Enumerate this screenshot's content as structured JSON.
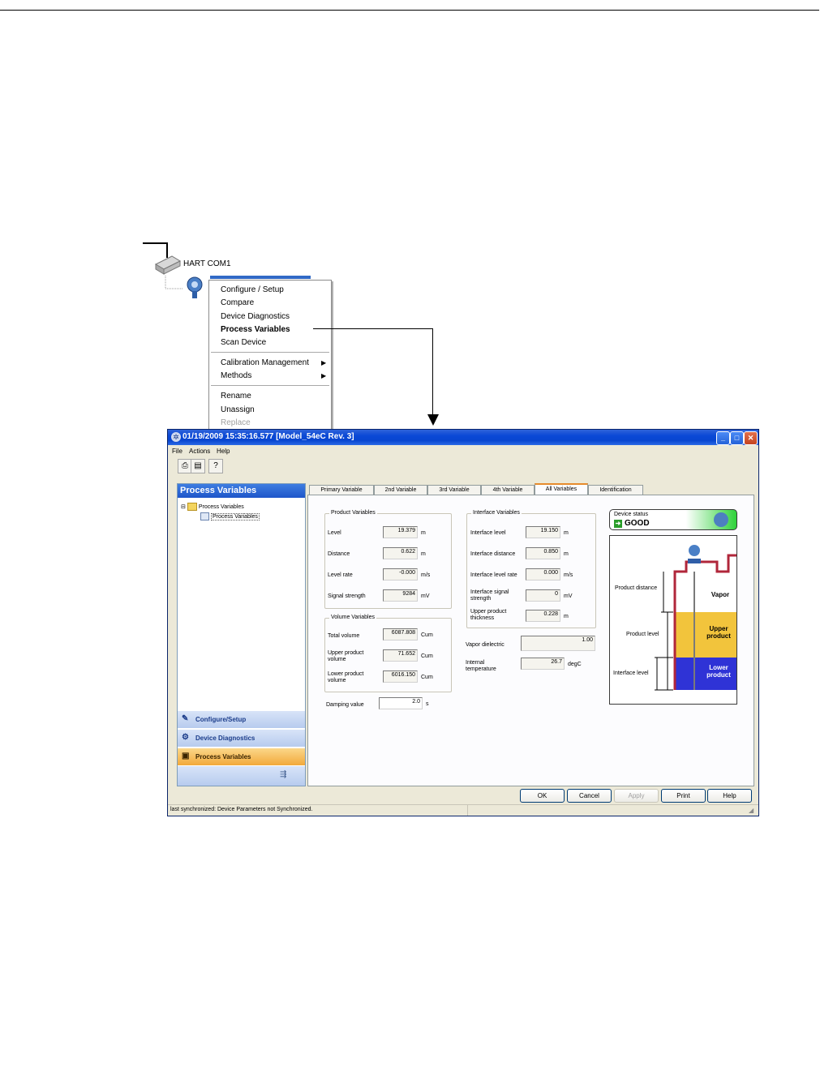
{
  "tree": {
    "hart_label": "HART COM1"
  },
  "context_menu": {
    "group1": [
      "Configure / Setup",
      "Compare",
      "Device Diagnostics",
      "Process Variables",
      "Scan Device"
    ],
    "group2": [
      "Calibration Management",
      "Methods"
    ],
    "group3": [
      "Rename",
      "Unassign",
      "Replace"
    ]
  },
  "window": {
    "title": "01/19/2009 15:35:16.577 [Model_54eC Rev. 3]",
    "menus": [
      "File",
      "Actions",
      "Help"
    ],
    "left_title": "Process Variables",
    "tree_root": "Process Variables",
    "tree_child": "Process Variables",
    "nav": [
      "Configure/Setup",
      "Device Diagnostics",
      "Process Variables"
    ],
    "tabs": [
      "Primary Variable",
      "2nd Variable",
      "3rd Variable",
      "4th Variable",
      "All Variables",
      "Identification"
    ]
  },
  "product": {
    "title": "Product Variables",
    "rows": [
      {
        "label": "Level",
        "value": "19.379",
        "unit": "m"
      },
      {
        "label": "Distance",
        "value": "0.622",
        "unit": "m"
      },
      {
        "label": "Level rate",
        "value": "-0.000",
        "unit": "m/s"
      },
      {
        "label": "Signal strength",
        "value": "9284",
        "unit": "mV"
      }
    ]
  },
  "volume": {
    "title": "Volume Variables",
    "rows": [
      {
        "label": "Total volume",
        "value": "6087.808",
        "unit": "Cum"
      },
      {
        "label": "Upper product volume",
        "value": "71.652",
        "unit": "Cum"
      },
      {
        "label": "Lower product volume",
        "value": "6016.150",
        "unit": "Cum"
      }
    ]
  },
  "damping": {
    "label": "Damping value",
    "value": "2.0",
    "unit": "s"
  },
  "interface": {
    "title": "Interface Variables",
    "rows": [
      {
        "label": "Interface level",
        "value": "19.150",
        "unit": "m"
      },
      {
        "label": "Interface distance",
        "value": "0.850",
        "unit": "m"
      },
      {
        "label": "Interface level rate",
        "value": "0.000",
        "unit": "m/s"
      },
      {
        "label": "Interface signal strength",
        "value": "0",
        "unit": "mV"
      },
      {
        "label": "Upper product thickness",
        "value": "0.228",
        "unit": "m"
      }
    ]
  },
  "vapor": {
    "label": "Vapor dielectric",
    "value": "1.00"
  },
  "internal_temp": {
    "label": "Internal temperature",
    "value": "26.7",
    "unit": "degC"
  },
  "status": {
    "title": "Device status",
    "value": "GOOD"
  },
  "tank": {
    "product_distance": "Product distance",
    "product_level": "Product level",
    "interface_level": "Interface level",
    "vapor": "Vapor",
    "upper": "Upper product",
    "lower": "Lower product"
  },
  "buttons": [
    "OK",
    "Cancel",
    "Apply",
    "Print",
    "Help"
  ],
  "statusbar": "last synchronized: Device Parameters not Synchronized."
}
